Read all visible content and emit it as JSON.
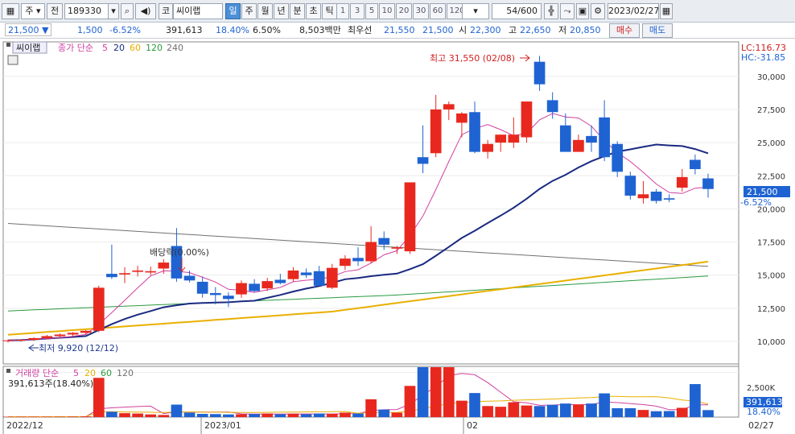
{
  "toolbar": {
    "market_label": "주",
    "prev_label": "전",
    "code": "189330",
    "name_prefix": "코",
    "name": "씨이랩",
    "periods": [
      "일",
      "주",
      "월",
      "년",
      "분",
      "초",
      "틱"
    ],
    "active_period": "일",
    "intervals": [
      "1",
      "3",
      "5",
      "10",
      "20",
      "30",
      "60",
      "120"
    ],
    "count": "54",
    "count_total": "/600",
    "date": "2023/02/27"
  },
  "quote": {
    "price": "21,500",
    "change": "1,500",
    "change_pct": "-6.52%",
    "volume": "391,613",
    "volume_pct": "18.40%",
    "turnover_pct": "6.50%",
    "amount": "8,503백만",
    "best_label": "최우선",
    "best_ask": "21,550",
    "best_bid": "21,500",
    "open_label": "시",
    "open": "22,300",
    "high_label": "고",
    "high": "22,650",
    "low_label": "저",
    "low": "20,850",
    "buy_label": "매수",
    "sell_label": "매도"
  },
  "price_panel": {
    "stock_label": "씨이랩",
    "legend_prefix": "종가 단순",
    "ma_periods": [
      "5",
      "20",
      "60",
      "120",
      "240"
    ],
    "lc": "LC:116.73",
    "hc": "HC:-31.85",
    "high_annot": "최고 31,550 (02/08)",
    "low_annot": "최저 9,920 (12/12)",
    "dividend_annot": "배당락(0.00%)",
    "current_price_tag": "21,500",
    "current_pct_tag": "-6.52%"
  },
  "volume_panel": {
    "legend_prefix": "거래량 단순",
    "ma_periods": [
      "5",
      "20",
      "60",
      "120"
    ],
    "value_text": "391,613주(18.40%)",
    "tick_label": "2,500K",
    "current_tag": "391,613",
    "pct_tag": "18.40%"
  },
  "x_labels": [
    "2022/12",
    "2023/01",
    "02"
  ],
  "end_date_label": "02/27",
  "colors": {
    "up": "#e8281e",
    "down": "#1f63d2",
    "ma5": "#d040a0",
    "ma20": "#1a2a80",
    "ma60": "#e8b000",
    "ma120": "#2a9a40",
    "ma240": "#707070"
  },
  "chart_data": {
    "type": "candlestick",
    "y_ticks": [
      10000,
      12500,
      15000,
      17500,
      20000,
      22500,
      25000,
      27500,
      30000
    ],
    "ylim": [
      8300,
      32600
    ],
    "candles": [
      {
        "o": 10050,
        "h": 10150,
        "l": 9920,
        "c": 10080
      },
      {
        "o": 10080,
        "h": 10160,
        "l": 9980,
        "c": 10120
      },
      {
        "o": 10120,
        "h": 10300,
        "l": 10050,
        "c": 10250
      },
      {
        "o": 10250,
        "h": 10500,
        "l": 10150,
        "c": 10400
      },
      {
        "o": 10400,
        "h": 10600,
        "l": 10300,
        "c": 10520
      },
      {
        "o": 10520,
        "h": 10700,
        "l": 10400,
        "c": 10650
      },
      {
        "o": 10650,
        "h": 10850,
        "l": 10500,
        "c": 10800
      },
      {
        "o": 10800,
        "h": 14200,
        "l": 10700,
        "c": 14050
      },
      {
        "o": 15100,
        "h": 17300,
        "l": 14700,
        "c": 14850
      },
      {
        "o": 15050,
        "h": 15600,
        "l": 14400,
        "c": 15150
      },
      {
        "o": 15250,
        "h": 15700,
        "l": 14900,
        "c": 15350
      },
      {
        "o": 15200,
        "h": 15650,
        "l": 15000,
        "c": 15300
      },
      {
        "o": 15500,
        "h": 16200,
        "l": 15100,
        "c": 15950
      },
      {
        "o": 17200,
        "h": 18550,
        "l": 14500,
        "c": 14750
      },
      {
        "o": 14950,
        "h": 15350,
        "l": 14450,
        "c": 14600
      },
      {
        "o": 14500,
        "h": 14900,
        "l": 13300,
        "c": 13600
      },
      {
        "o": 13650,
        "h": 14100,
        "l": 12800,
        "c": 13500
      },
      {
        "o": 13450,
        "h": 13700,
        "l": 12600,
        "c": 13200
      },
      {
        "o": 13550,
        "h": 14600,
        "l": 13300,
        "c": 14400
      },
      {
        "o": 14350,
        "h": 14700,
        "l": 13700,
        "c": 13800
      },
      {
        "o": 14000,
        "h": 14800,
        "l": 13800,
        "c": 14550
      },
      {
        "o": 14650,
        "h": 15100,
        "l": 14300,
        "c": 14400
      },
      {
        "o": 14700,
        "h": 15600,
        "l": 14500,
        "c": 15350
      },
      {
        "o": 15200,
        "h": 15500,
        "l": 14800,
        "c": 15000
      },
      {
        "o": 15300,
        "h": 15700,
        "l": 14900,
        "c": 14200
      },
      {
        "o": 14050,
        "h": 15850,
        "l": 13950,
        "c": 15550
      },
      {
        "o": 15700,
        "h": 16500,
        "l": 15400,
        "c": 16250
      },
      {
        "o": 16300,
        "h": 17100,
        "l": 15700,
        "c": 16050
      },
      {
        "o": 16050,
        "h": 18700,
        "l": 15900,
        "c": 17500
      },
      {
        "o": 17800,
        "h": 18300,
        "l": 16900,
        "c": 17300
      },
      {
        "o": 17000,
        "h": 17200,
        "l": 16600,
        "c": 17100
      },
      {
        "o": 16800,
        "h": 22000,
        "l": 16600,
        "c": 22000
      },
      {
        "o": 23900,
        "h": 26300,
        "l": 22700,
        "c": 23400
      },
      {
        "o": 24200,
        "h": 28600,
        "l": 23900,
        "c": 27500
      },
      {
        "o": 27500,
        "h": 28100,
        "l": 26700,
        "c": 27900
      },
      {
        "o": 26500,
        "h": 27300,
        "l": 25400,
        "c": 27200
      },
      {
        "o": 27300,
        "h": 28100,
        "l": 24200,
        "c": 24300
      },
      {
        "o": 24300,
        "h": 25200,
        "l": 23800,
        "c": 24900
      },
      {
        "o": 25000,
        "h": 25600,
        "l": 24300,
        "c": 25600
      },
      {
        "o": 25000,
        "h": 26900,
        "l": 24600,
        "c": 25600
      },
      {
        "o": 25400,
        "h": 28100,
        "l": 25000,
        "c": 28100
      },
      {
        "o": 31100,
        "h": 31550,
        "l": 28900,
        "c": 29400
      },
      {
        "o": 28200,
        "h": 28800,
        "l": 26800,
        "c": 27300
      },
      {
        "o": 26300,
        "h": 27200,
        "l": 24800,
        "c": 24300
      },
      {
        "o": 24300,
        "h": 25600,
        "l": 24500,
        "c": 25200
      },
      {
        "o": 25500,
        "h": 26300,
        "l": 24300,
        "c": 25000
      },
      {
        "o": 26900,
        "h": 28200,
        "l": 23600,
        "c": 23900
      },
      {
        "o": 24900,
        "h": 25100,
        "l": 22400,
        "c": 22800
      },
      {
        "o": 22500,
        "h": 22800,
        "l": 20700,
        "c": 21000
      },
      {
        "o": 20800,
        "h": 22100,
        "l": 20400,
        "c": 21100
      },
      {
        "o": 21300,
        "h": 21500,
        "l": 20400,
        "c": 20600
      },
      {
        "o": 20800,
        "h": 21100,
        "l": 20500,
        "c": 20700
      },
      {
        "o": 21600,
        "h": 23000,
        "l": 21300,
        "c": 22400
      },
      {
        "o": 23700,
        "h": 24100,
        "l": 22600,
        "c": 23000
      },
      {
        "o": 22300,
        "h": 22650,
        "l": 20850,
        "c": 21500
      }
    ],
    "volume": {
      "ylim": [
        0,
        2800000
      ],
      "values": [
        20000,
        20000,
        20000,
        20000,
        25000,
        30000,
        40000,
        2200000,
        300000,
        220000,
        200000,
        150000,
        120000,
        700000,
        250000,
        180000,
        170000,
        150000,
        160000,
        170000,
        200000,
        160000,
        190000,
        160000,
        200000,
        180000,
        250000,
        200000,
        1000000,
        420000,
        250000,
        1750000,
        2800000,
        3300000,
        3500000,
        920000,
        1350000,
        620000,
        580000,
        830000,
        650000,
        620000,
        690000,
        760000,
        710000,
        760000,
        1330000,
        500000,
        500000,
        400000,
        330000,
        340000,
        520000,
        1850000,
        391613
      ],
      "tick": 2500000
    },
    "x_labels": [
      "2022/12",
      "2023/01",
      "02"
    ],
    "legend": [
      "5",
      "20",
      "60",
      "120",
      "240"
    ]
  }
}
